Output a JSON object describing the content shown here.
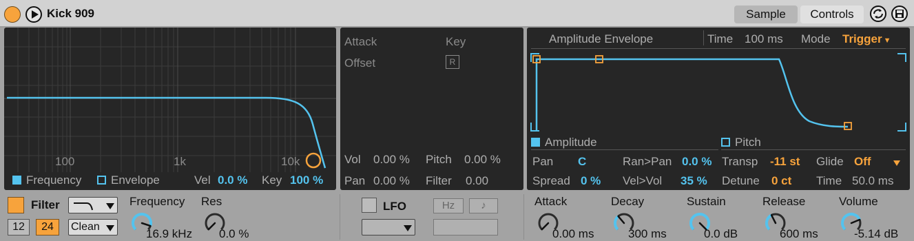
{
  "titlebar": {
    "device_name": "Kick 909",
    "tabs": [
      "Sample",
      "Controls"
    ],
    "colors": {
      "accent": "#f7a33c",
      "blue": "#54c3ee"
    }
  },
  "filter_display": {
    "freq_ticks": [
      "100",
      "1k",
      "10k"
    ],
    "legend_frequency": "Frequency",
    "legend_envelope": "Envelope",
    "vel_label": "Vel",
    "vel_value": "0.0 %",
    "key_label": "Key",
    "key_value": "100 %"
  },
  "mod_panel": {
    "attack": "Attack",
    "key": "Key",
    "offset": "Offset",
    "r_button": "R",
    "vol_label": "Vol",
    "vol_value": "0.00 %",
    "pitch_label": "Pitch",
    "pitch_value": "0.00 %",
    "pan_label": "Pan",
    "pan_value": "0.00 %",
    "filter_label": "Filter",
    "filter_value": "0.00"
  },
  "envelope": {
    "title": "Amplitude Envelope",
    "time_label": "Time",
    "time_value": "100 ms",
    "mode_label": "Mode",
    "mode_value": "Trigger",
    "legend_amplitude": "Amplitude",
    "legend_pitch": "Pitch",
    "pan_label": "Pan",
    "pan_value": "C",
    "ranpan_label": "Ran>Pan",
    "ranpan_value": "0.0 %",
    "transp_label": "Transp",
    "transp_value": "-11 st",
    "glide_label": "Glide",
    "glide_value": "Off",
    "spread_label": "Spread",
    "spread_value": "0 %",
    "velvol_label": "Vel>Vol",
    "velvol_value": "35 %",
    "detune_label": "Detune",
    "detune_value": "0 ct",
    "ptime_label": "Time",
    "ptime_value": "50.0 ms"
  },
  "filter_controls": {
    "label": "Filter",
    "slope_12": "12",
    "slope_24": "24",
    "circuit": "Clean",
    "frequency_label": "Frequency",
    "frequency_value": "16.9 kHz",
    "frequency_level": 0.9,
    "res_label": "Res",
    "res_value": "0.0 %",
    "res_level": 0.0
  },
  "lfo_controls": {
    "label": "LFO",
    "hz": "Hz",
    "note_icon": "♪"
  },
  "amp_controls": {
    "knobs": [
      {
        "label": "Attack",
        "value": "0.00 ms",
        "level": 0.0
      },
      {
        "label": "Decay",
        "value": "300 ms",
        "level": 0.35
      },
      {
        "label": "Sustain",
        "value": "0.0 dB",
        "level": 1.0
      },
      {
        "label": "Release",
        "value": "600 ms",
        "level": 0.4
      },
      {
        "label": "Volume",
        "value": "-5.14 dB",
        "level": 0.75
      }
    ]
  }
}
